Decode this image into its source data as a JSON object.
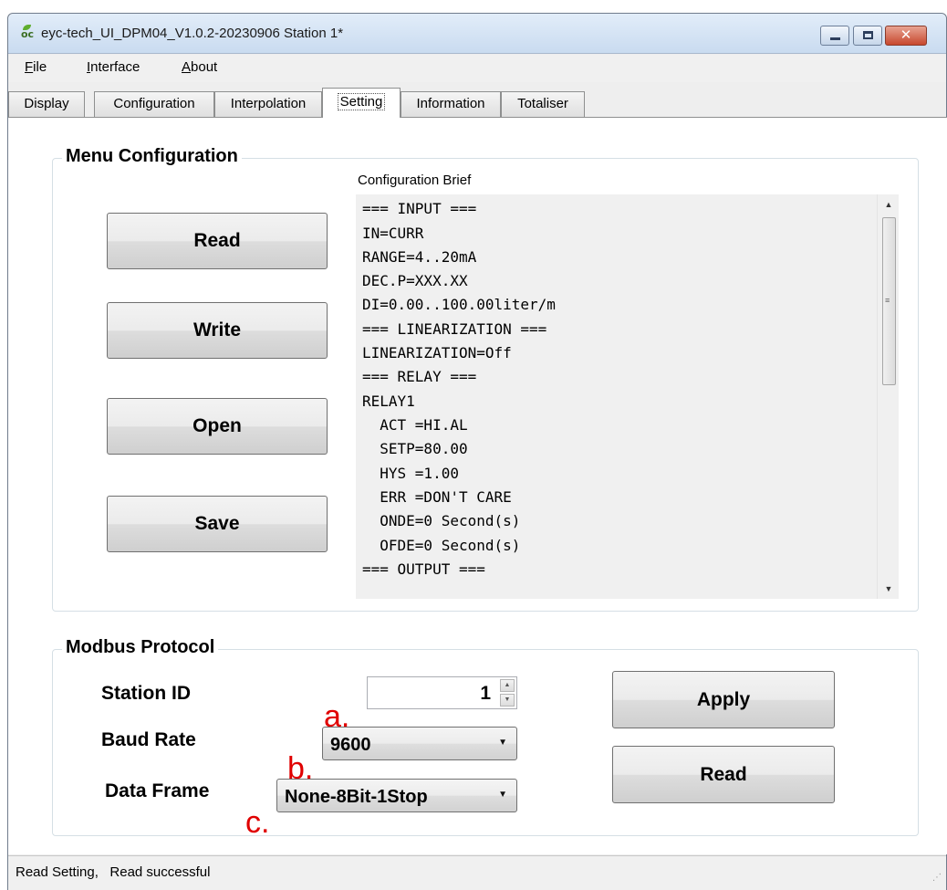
{
  "window": {
    "title": "eyc-tech_UI_DPM04_V1.0.2-20230906  Station 1*",
    "app_icon": "eyc-logo-icon",
    "controls": {
      "minimize": "minimize-icon",
      "maximize": "maximize-icon",
      "close": "✕"
    }
  },
  "menu": [
    {
      "mnemonic": "F",
      "rest": "ile"
    },
    {
      "mnemonic": "I",
      "rest": "nterface"
    },
    {
      "mnemonic": "A",
      "rest": "bout"
    }
  ],
  "tabs": [
    "Display",
    "Configuration",
    "Interpolation",
    "Setting",
    "Information",
    "Totaliser"
  ],
  "active_tab": "Setting",
  "menu_configuration": {
    "title": "Menu Configuration",
    "buttons": {
      "read": "Read",
      "write": "Write",
      "open": "Open",
      "save": "Save"
    },
    "brief_label": "Configuration Brief",
    "brief_lines": [
      "=== INPUT ===",
      "IN=CURR",
      "RANGE=4..20mA",
      "DEC.P=XXX.XX",
      "DI=0.00..100.00liter/m",
      "=== LINEARIZATION ===",
      "LINEARIZATION=Off",
      "=== RELAY ===",
      "RELAY1",
      "  ACT =HI.AL",
      "  SETP=80.00",
      "  HYS =1.00",
      "  ERR =DON'T CARE",
      "  ONDE=0 Second(s)",
      "  OFDE=0 Second(s)",
      "=== OUTPUT ==="
    ]
  },
  "modbus": {
    "title": "Modbus Protocol",
    "station_id_label": "Station ID",
    "station_id_value": "1",
    "baud_rate_label": "Baud Rate",
    "baud_rate_value": "9600",
    "data_frame_label": "Data Frame",
    "data_frame_value": "None-8Bit-1Stop",
    "apply_button": "Apply",
    "read_button": "Read"
  },
  "annotations": {
    "a": "a.",
    "b": "b.",
    "c": "c."
  },
  "status": "Read Setting,   Read successful",
  "colors": {
    "annotation": "#e00000",
    "title_bar": "#c9dbf0",
    "close_button": "#c7472d"
  }
}
